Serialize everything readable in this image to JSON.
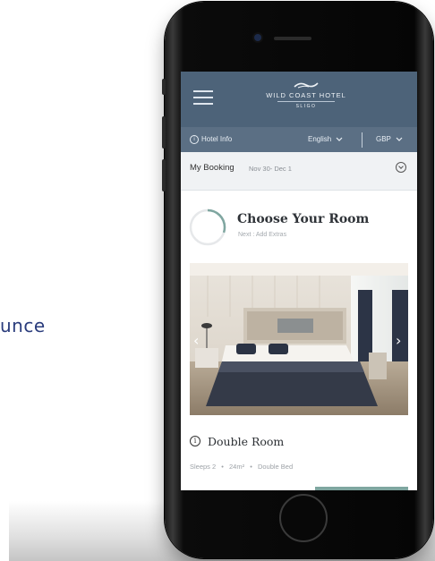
{
  "background": {
    "partial_text": "unce",
    "accent": "#2a3c7c"
  },
  "hotel": {
    "name": "WILD COAST HOTEL",
    "location": "SLIGO",
    "header_color": "#4d6379"
  },
  "toolbar": {
    "hotel_info": "Hotel Info",
    "language": "English",
    "currency": "GBP"
  },
  "booking": {
    "label": "My Booking",
    "dates": "Nov 30- Dec 1"
  },
  "step": {
    "title": "Choose Your Room",
    "next": "Next : Add Extras",
    "progress": 0.3,
    "accent": "#7fa6a0"
  },
  "room": {
    "name": "Double Room",
    "sleeps": "Sleeps 2",
    "size": "24m²",
    "bed": "Double Bed",
    "separator": "•"
  },
  "icons": {
    "menu": "hamburger-icon",
    "info": "info-icon",
    "chevron": "chevron-down-icon",
    "prev": "chevron-left-icon",
    "next": "chevron-right-icon"
  }
}
